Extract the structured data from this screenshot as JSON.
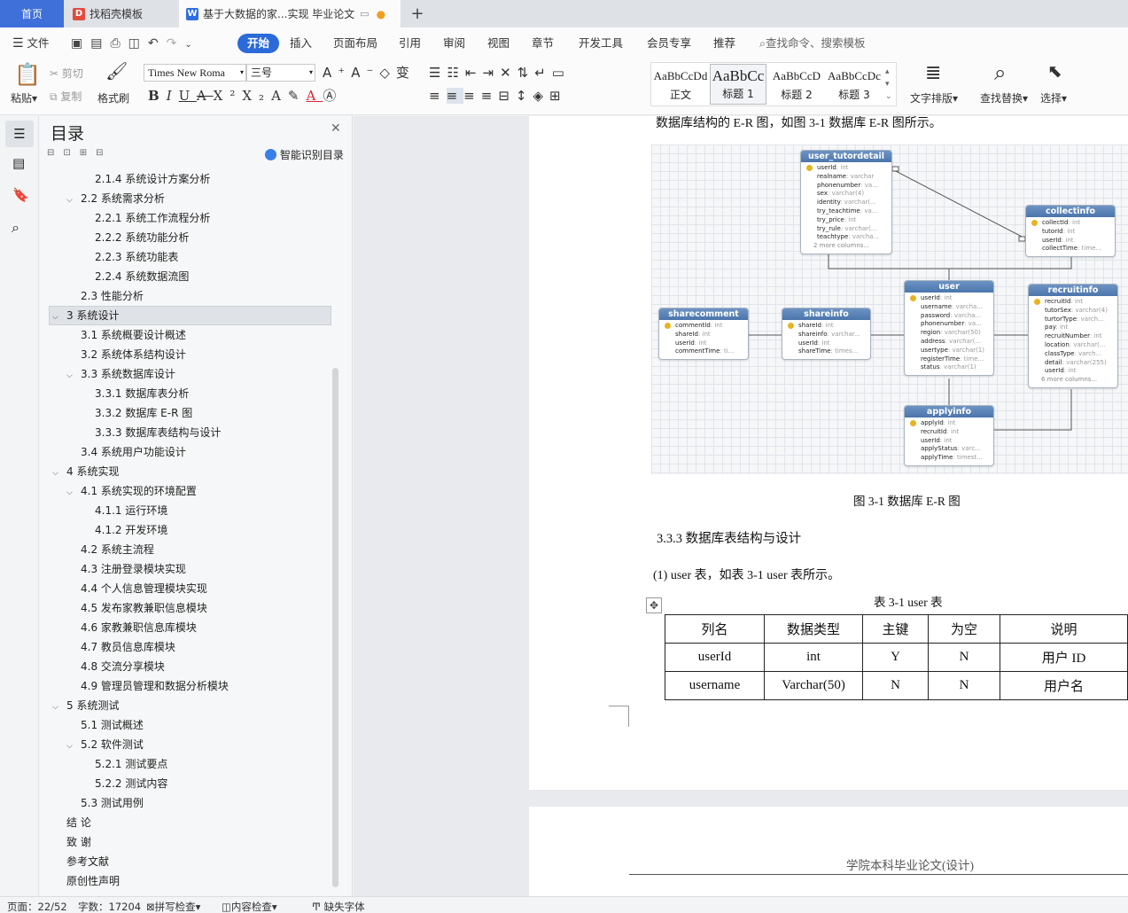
{
  "tabs": [
    {
      "label": "首页"
    },
    {
      "label": "找稻壳模板"
    },
    {
      "label": "基于大数据的家...实现 毕业论文"
    }
  ],
  "new_tab_symbol": "+",
  "menu": {
    "file": "文件",
    "items": [
      "开始",
      "插入",
      "页面布局",
      "引用",
      "审阅",
      "视图",
      "章节",
      "开发工具",
      "会员专享",
      "推荐"
    ],
    "search_placeholder": "查找命令、搜索模板"
  },
  "ribbon": {
    "paste": "粘贴",
    "cut": "剪切",
    "copy": "复制",
    "format_painter": "格式刷",
    "font_name": "Times New Roma",
    "font_size": "三号",
    "styles": [
      {
        "preview": "AaBbCcDd",
        "name": "正文"
      },
      {
        "preview": "AaBbCc",
        "name": "标题 1"
      },
      {
        "preview": "AaBbCcD",
        "name": "标题 2"
      },
      {
        "preview": "AaBbCcDc",
        "name": "标题 3"
      }
    ],
    "text_layout": "文字排版",
    "find_replace": "查找替换",
    "select": "选择"
  },
  "toc": {
    "title": "目录",
    "smart_toc": "智能识别目录",
    "items": [
      {
        "label": "2.1.4  系统设计方案分析",
        "level": 3,
        "expand": ""
      },
      {
        "label": "2.2  系统需求分析",
        "level": 2,
        "expand": "v"
      },
      {
        "label": "2.2.1  系统工作流程分析",
        "level": 3,
        "expand": ""
      },
      {
        "label": "2.2.2  系统功能分析",
        "level": 3,
        "expand": ""
      },
      {
        "label": "2.2.3  系统功能表",
        "level": 3,
        "expand": ""
      },
      {
        "label": "2.2.4  系统数据流图",
        "level": 3,
        "expand": ""
      },
      {
        "label": "2.3  性能分析",
        "level": 2,
        "expand": ""
      },
      {
        "label": "3  系统设计",
        "level": 1,
        "expand": "v",
        "selected": true
      },
      {
        "label": "3.1  系统概要设计概述",
        "level": 2,
        "expand": ""
      },
      {
        "label": "3.2  系统体系结构设计",
        "level": 2,
        "expand": ""
      },
      {
        "label": "3.3  系统数据库设计",
        "level": 2,
        "expand": "v"
      },
      {
        "label": "3.3.1  数据库表分析",
        "level": 3,
        "expand": ""
      },
      {
        "label": "3.3.2  数据库 E-R 图",
        "level": 3,
        "expand": ""
      },
      {
        "label": "3.3.3  数据库表结构与设计",
        "level": 3,
        "expand": ""
      },
      {
        "label": "3.4  系统用户功能设计",
        "level": 2,
        "expand": ""
      },
      {
        "label": "4  系统实现",
        "level": 1,
        "expand": "v"
      },
      {
        "label": "4.1  系统实现的环境配置",
        "level": 2,
        "expand": "v"
      },
      {
        "label": "4.1.1  运行环境",
        "level": 3,
        "expand": ""
      },
      {
        "label": "4.1.2  开发环境",
        "level": 3,
        "expand": ""
      },
      {
        "label": "4.2  系统主流程",
        "level": 2,
        "expand": ""
      },
      {
        "label": "4.3  注册登录模块实现",
        "level": 2,
        "expand": ""
      },
      {
        "label": "4.4  个人信息管理模块实现",
        "level": 2,
        "expand": ""
      },
      {
        "label": "4.5  发布家教兼职信息模块",
        "level": 2,
        "expand": ""
      },
      {
        "label": "4.6  家教兼职信息库模块",
        "level": 2,
        "expand": ""
      },
      {
        "label": "4.7  教员信息库模块",
        "level": 2,
        "expand": ""
      },
      {
        "label": "4.8  交流分享模块",
        "level": 2,
        "expand": ""
      },
      {
        "label": "4.9  管理员管理和数据分析模块",
        "level": 2,
        "expand": ""
      },
      {
        "label": "5  系统测试",
        "level": 1,
        "expand": "v"
      },
      {
        "label": "5.1  测试概述",
        "level": 2,
        "expand": ""
      },
      {
        "label": "5.2  软件测试",
        "level": 2,
        "expand": "v"
      },
      {
        "label": "5.2.1  测试要点",
        "level": 3,
        "expand": ""
      },
      {
        "label": "5.2.2  测试内容",
        "level": 3,
        "expand": ""
      },
      {
        "label": "5.3  测试用例",
        "level": 2,
        "expand": ""
      },
      {
        "label": "结    论",
        "level": 1,
        "expand": ""
      },
      {
        "label": "致    谢",
        "level": 1,
        "expand": ""
      },
      {
        "label": "参考文献",
        "level": 1,
        "expand": ""
      },
      {
        "label": "原创性声明",
        "level": 1,
        "expand": ""
      }
    ]
  },
  "document": {
    "top_line": "数据库结构的 E-R 图，如图 3-1 数据库 E-R 图所示。",
    "figure_caption": "图 3-1 数据库 E-R 图",
    "section_heading": "3.3.3  数据库表结构与设计",
    "paragraph": "(1)  user 表，如表 3-1 user 表所示。",
    "table_caption": "表 3-1 user 表",
    "table": {
      "headers": [
        "列名",
        "数据类型",
        "主键",
        "为空",
        "说明"
      ],
      "rows": [
        [
          "userId",
          "int",
          "Y",
          "N",
          "用户 ID"
        ],
        [
          "username",
          "Varchar(50)",
          "N",
          "N",
          "用户名"
        ]
      ]
    },
    "page_header": "学院本科毕业论文(设计)"
  },
  "er_entities": [
    {
      "name": "user_tutordetail",
      "fields": [
        [
          "userId",
          "int",
          true
        ],
        [
          "realname",
          "varchar",
          false
        ],
        [
          "phonenumber",
          "va...",
          false
        ],
        [
          "sex",
          "varchar(4)",
          false
        ],
        [
          "identity",
          "varchar(...",
          false
        ],
        [
          "try_teachtime",
          "va...",
          false
        ],
        [
          "try_price",
          "int",
          false
        ],
        [
          "try_rule",
          "varchar(...",
          false
        ],
        [
          "teachtype",
          "varcha...",
          false
        ]
      ],
      "more": "2 more columns..."
    },
    {
      "name": "collectinfo",
      "fields": [
        [
          "collectId",
          "int",
          true
        ],
        [
          "tutorId",
          "int",
          false
        ],
        [
          "userId",
          "int",
          false
        ],
        [
          "collectTime",
          "time...",
          false
        ]
      ],
      "more": ""
    },
    {
      "name": "user",
      "fields": [
        [
          "userId",
          "int",
          true
        ],
        [
          "username",
          "varcha...",
          false
        ],
        [
          "password",
          "varcha...",
          false
        ],
        [
          "phonenumber",
          "va...",
          false
        ],
        [
          "region",
          "varchar(50)",
          false
        ],
        [
          "address",
          "varchar(...",
          false
        ],
        [
          "usertype",
          "varchar(1)",
          false
        ],
        [
          "registerTime",
          "time...",
          false
        ],
        [
          "status",
          "varchar(1)",
          false
        ]
      ],
      "more": ""
    },
    {
      "name": "recruitinfo",
      "fields": [
        [
          "recruitId",
          "int",
          true
        ],
        [
          "tutorSex",
          "varchar(4)",
          false
        ],
        [
          "turtorType",
          "varch...",
          false
        ],
        [
          "pay",
          "int",
          false
        ],
        [
          "recruitNumber",
          "int",
          false
        ],
        [
          "location",
          "varchar(...",
          false
        ],
        [
          "classType",
          "varch...",
          false
        ],
        [
          "detail",
          "varchar(255)",
          false
        ],
        [
          "userId",
          "int",
          false
        ]
      ],
      "more": "6 more columns..."
    },
    {
      "name": "sharecomment",
      "fields": [
        [
          "commentId",
          "int",
          true
        ],
        [
          "shareId",
          "int",
          false
        ],
        [
          "userId",
          "int",
          false
        ],
        [
          "commentTime",
          "ti...",
          false
        ]
      ],
      "more": ""
    },
    {
      "name": "shareinfo",
      "fields": [
        [
          "shareId",
          "int",
          true
        ],
        [
          "shareinfo",
          "varchar...",
          false
        ],
        [
          "userId",
          "int",
          false
        ],
        [
          "shareTime",
          "times...",
          false
        ]
      ],
      "more": ""
    },
    {
      "name": "applyinfo",
      "fields": [
        [
          "applyId",
          "int",
          true
        ],
        [
          "recruitId",
          "int",
          false
        ],
        [
          "userId",
          "int",
          false
        ],
        [
          "applyStatus",
          "varc...",
          false
        ],
        [
          "applyTime",
          "timest...",
          false
        ]
      ],
      "more": ""
    }
  ],
  "status": {
    "page": "页面：22/52",
    "words": "字数：17204",
    "spell": "拼写检查",
    "content": "内容检查",
    "missing_font": "缺失字体"
  },
  "colors": {
    "accent": "#2a6ad9",
    "er_header": "#5a82b8",
    "selected": "#dfe2e6"
  }
}
